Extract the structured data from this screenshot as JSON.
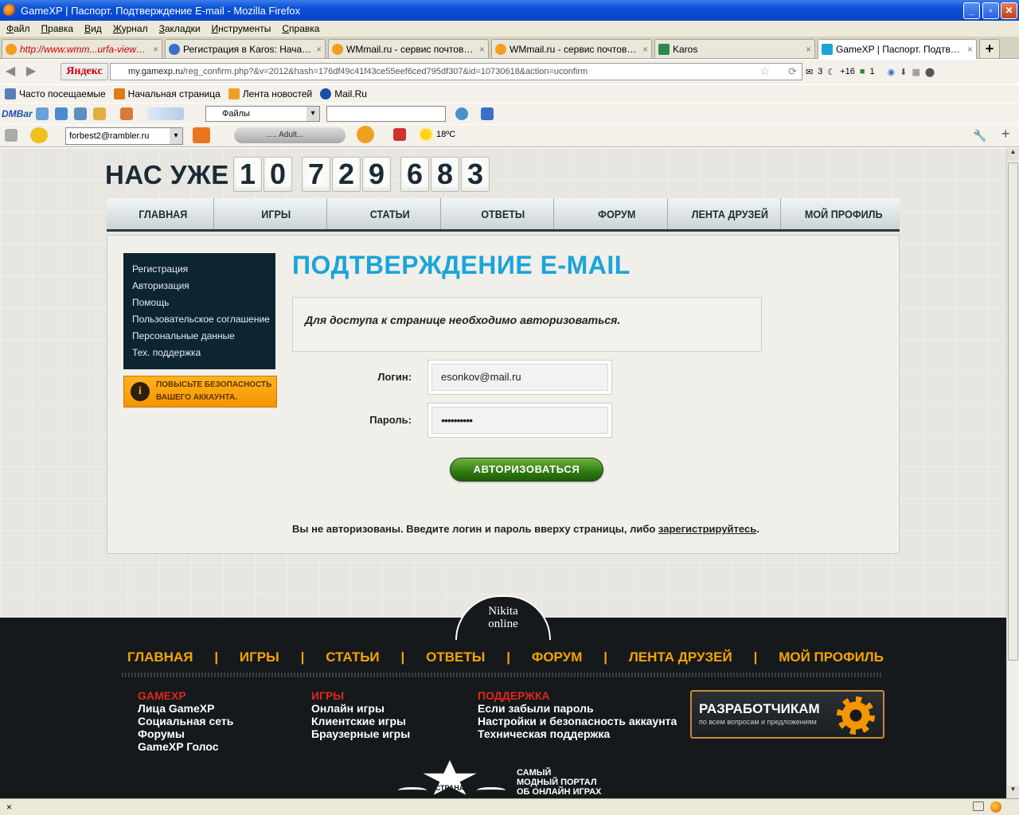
{
  "window": {
    "title": "GameXP | Паспорт. Подтверждение E-mail - Mozilla Firefox",
    "controls": {
      "minimize": "_",
      "maximize": "▫",
      "close": "✕"
    }
  },
  "menubar": [
    "Файл",
    "Правка",
    "Вид",
    "Журнал",
    "Закладки",
    "Инструменты",
    "Справка"
  ],
  "tabs": [
    {
      "label": "http://www.wmm...urfa-viewsrite",
      "icon_color": "#f0a020",
      "active": false
    },
    {
      "label": "Регистрация в Karos: Начало ...",
      "icon_color": "#3a6fc8",
      "active": false
    },
    {
      "label": "WMmail.ru - сервис почтовых ...",
      "icon_color": "#f0a020",
      "active": false
    },
    {
      "label": "WMmail.ru - сервис почтовых ...",
      "icon_color": "#f0a020",
      "active": false
    },
    {
      "label": "Karos",
      "icon_color": "#2d8a4a",
      "active": false
    },
    {
      "label": "GameXP | Паспорт. Подтвержд...",
      "icon_color": "#1aa5d8",
      "active": true
    }
  ],
  "tab_close": "×",
  "new_tab": "+",
  "navbar": {
    "back_icon": "◀",
    "forward_icon": "▶",
    "yandex": "Яндекс",
    "url_host": "my.gamexp.ru",
    "url_path": "/reg_confirm.php?&v=2012&hash=176df49c41f43ce55eef6ced795df307&id=10730618&action=uconfirm",
    "mail_count": "3",
    "moon_count": "+16",
    "green_count": "1"
  },
  "bookmarks": [
    {
      "label": "Часто посещаемые",
      "icon_color": "#5b7fb8"
    },
    {
      "label": "Начальная страница",
      "icon_color": "#e07a1a"
    },
    {
      "label": "Лента новостей",
      "icon_color": "#f0a020"
    },
    {
      "label": "Mail.Ru",
      "icon_color": "#1d4fa8"
    }
  ],
  "dmbar": {
    "label": "DMBar",
    "files": "Файлы"
  },
  "toolbar3": {
    "email": "forbest2@rambler.ru",
    "player_text": "..... Adult...",
    "weather": "18ºC"
  },
  "site": {
    "counter_label": "НАС УЖЕ",
    "digits": [
      "1",
      "0",
      "7",
      "2",
      "9",
      "6",
      "8",
      "3"
    ],
    "nav": [
      "ГЛАВНАЯ",
      "ИГРЫ",
      "СТАТЬИ",
      "ОТВЕТЫ",
      "ФОРУМ",
      "ЛЕНТА ДРУЗЕЙ",
      "МОЙ ПРОФИЛЬ"
    ],
    "side_menu": [
      "Регистрация",
      "Авторизация",
      "Помощь",
      "Пользовательское соглашение",
      "Персональные данные",
      "Тех. поддержка"
    ],
    "security_button": {
      "icon": "i",
      "line1": "ПОВЫСЬТЕ БЕЗОПАСНОСТЬ",
      "line2": "ВАШЕГО АККАУНТА."
    },
    "page_title": "ПОДТВЕРЖДЕНИЕ E-MAIL",
    "notice": "Для доступа к странице необходимо авторизоваться.",
    "login_label": "Логин:",
    "login_value": "esonkov@mail.ru",
    "password_label": "Пароль:",
    "password_value": "••••••••••",
    "auth_button": "АВТОРИЗОВАТЬСЯ",
    "auth_msg_prefix": "Вы не авторизованы. Введите логин и пароль вверху страницы, либо ",
    "auth_msg_link": "зарегистрируйтесь",
    "auth_msg_suffix": "."
  },
  "footer": {
    "logo_line1": "Nikita",
    "logo_line2": "online",
    "nav": [
      "ГЛАВНАЯ",
      "ИГРЫ",
      "СТАТЬИ",
      "ОТВЕТЫ",
      "ФОРУМ",
      "ЛЕНТА ДРУЗЕЙ",
      "МОЙ ПРОФИЛЬ"
    ],
    "separator": "|",
    "col1": {
      "heading": "GAMEXP",
      "links": [
        "Лица GameXP",
        "Социальная сеть",
        "Форумы",
        "GameXP Голос"
      ]
    },
    "col2": {
      "heading": "ИГРЫ",
      "links": [
        "Онлайн игры",
        "Клиентские игры",
        "Браузерные игры"
      ]
    },
    "col3": {
      "heading": "ПОДДЕРЖКА",
      "links": [
        "Если забыли пароль",
        "Настройки и безопасность аккаунта",
        "Техническая поддержка"
      ]
    },
    "dev_button": {
      "title": "РАЗРАБОТЧИКАМ",
      "subtitle": "по всем вопросам и предложениям"
    },
    "strana_label": "СТРАНА ИГР",
    "slogan": [
      "САМЫЙ",
      "МОДНЫЙ ПОРТАЛ",
      "ОБ ОНЛАЙН ИГРАХ"
    ]
  },
  "statusbar": {
    "close_icon": "×"
  }
}
